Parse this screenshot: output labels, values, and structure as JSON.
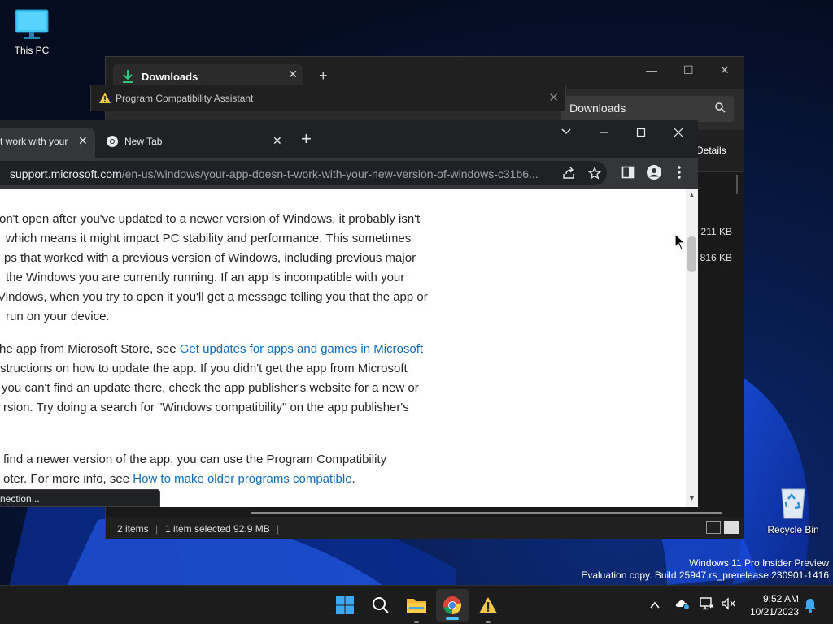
{
  "desktop": {
    "this_pc": "This PC",
    "recycle_bin": "Recycle Bin",
    "watermark_line1": "Windows 11 Pro Insider Preview",
    "watermark_line2": "Evaluation copy. Build 25947.rs_prerelease.230901-1416"
  },
  "explorer": {
    "tab_title": "Downloads",
    "tab_close": "✕",
    "new_tab": "+",
    "search_text": "Downloads",
    "details_label": "Details",
    "file_sizes": [
      "211 KB",
      "816 KB"
    ],
    "status_items": "2 items",
    "status_selected": "1 item selected  92.9 MB",
    "minimize": "—",
    "maximize": "☐",
    "close": "✕"
  },
  "compat_assistant": {
    "title": "Program Compatibility Assistant",
    "close": "✕"
  },
  "chrome": {
    "tab1_title": "t work with your",
    "tab1_close": "✕",
    "tab2_title": "New Tab",
    "tab2_close": "✕",
    "new_tab": "+",
    "url_domain": "support.microsoft.com",
    "url_path": "/en-us/windows/your-app-doesn-t-work-with-your-new-version-of-windows-c31b6...",
    "status_text": "nection...",
    "page": {
      "p1": [
        "on't open after you've updated to a newer version of Windows, it probably isn't",
        "which means it might impact PC stability and performance. This sometimes",
        "ps that worked with a previous version of Windows, including previous major",
        "the Windows you are currently running. If an app is incompatible with your",
        "Vindows, when you try to open it you'll get a message telling you that the app or",
        "run on your device."
      ],
      "p2_lead": "he app from Microsoft Store, see ",
      "p2_link": "Get updates for apps and games in Microsoft",
      "p2_rest": [
        "structions on how to update the app. If you didn't get the app from Microsoft",
        "you can't find an update there, check the app publisher's website for a new or",
        "rsion. Try doing a search for \"Windows compatibility\" on the app publisher's"
      ],
      "p3_line1": "find a newer version of the app, you can use the Program Compatibility",
      "p3_lead": "oter. For more info, see ",
      "p3_link": "How to make older programs compatible",
      "p3_tail": "."
    }
  },
  "taskbar": {
    "time": "9:52 AM",
    "date": "10/21/2023"
  },
  "colors": {
    "accent": "#4cc2ff",
    "link": "#0f6cbd",
    "warning": "#f2c84b"
  }
}
